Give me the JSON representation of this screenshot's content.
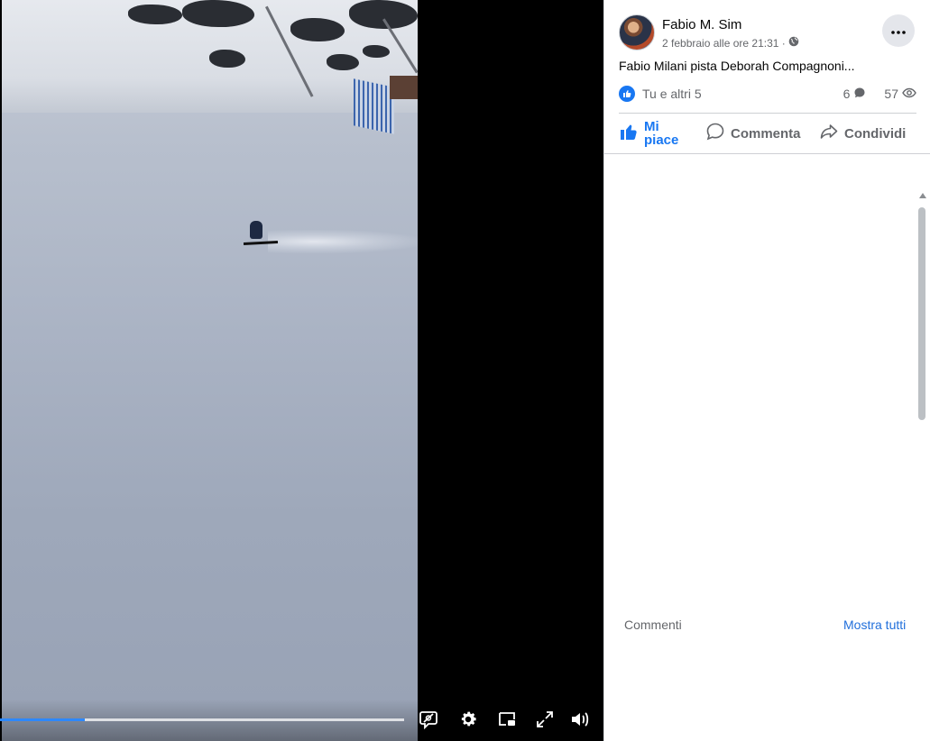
{
  "post": {
    "author": "Fabio M. Sim",
    "timestamp": "2 febbraio alle ore 21:31 ·",
    "privacy_icon": "globe-icon",
    "text": "Fabio Milani pista Deborah Compagnoni...",
    "more_icon": "more-horizontal-icon"
  },
  "reactions": {
    "summary": "Tu e altri 5",
    "comments_count": "6",
    "views_count": "57"
  },
  "actions": {
    "like": "Mi piace",
    "comment": "Commenta",
    "share": "Condividi"
  },
  "comments": {
    "label": "Commenti",
    "show_all": "Mostra tutti"
  },
  "video": {
    "progress": 0.21,
    "controls": [
      "captions-icon",
      "settings-gear-icon",
      "picture-in-picture-icon",
      "fullscreen-icon",
      "volume-icon"
    ]
  },
  "colors": {
    "accent": "#1877f2",
    "link": "#216fdb",
    "progress": "#2d88ff"
  }
}
